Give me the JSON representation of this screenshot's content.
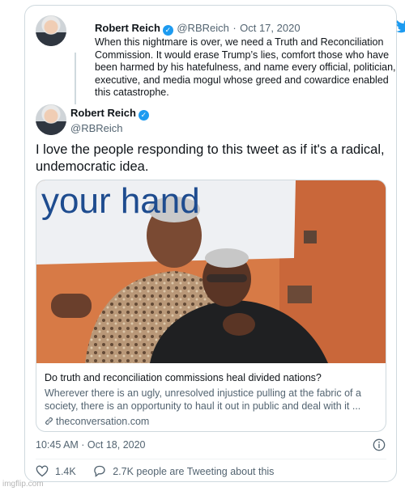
{
  "quoted_tweet": {
    "name": "Robert Reich",
    "handle": "@RBReich",
    "separator": "·",
    "date": "Oct 17, 2020",
    "text": "When this nightmare is over, we need a Truth and Reconciliation Commission. It would erase Trump’s lies, comfort those who have been harmed by his hatefulness, and name every official, politician, executive, and media mogul whose greed and cowardice enabled this catastrophe."
  },
  "tweet": {
    "name": "Robert Reich",
    "handle": "@RBReich",
    "text": "I love the people responding to this tweet as if it's a radical, undemocratic idea.",
    "timestamp": "10:45 AM · Oct 18, 2020",
    "likes": "1.4K",
    "tweeting_about": "2.7K people are Tweeting about this"
  },
  "link_card": {
    "banner_text": "your hand",
    "title": "Do truth and reconciliation commissions heal divided nations?",
    "description": "Wherever there is an ugly, unresolved injustice pulling at the fabric of a society, there is an opportunity to haul it out in public and deal with it ...",
    "domain": "theconversation.com"
  },
  "icons": {
    "brand": "twitter-bird-icon",
    "verified": "verified-badge-icon",
    "info": "info-icon",
    "like": "heart-icon",
    "reply": "speech-bubble-icon",
    "link": "link-icon"
  },
  "colors": {
    "brand_blue": "#1d9bf0",
    "text": "#0f1419",
    "muted": "#536471",
    "border": "#cfd9de"
  },
  "watermark": "imgflip.com"
}
